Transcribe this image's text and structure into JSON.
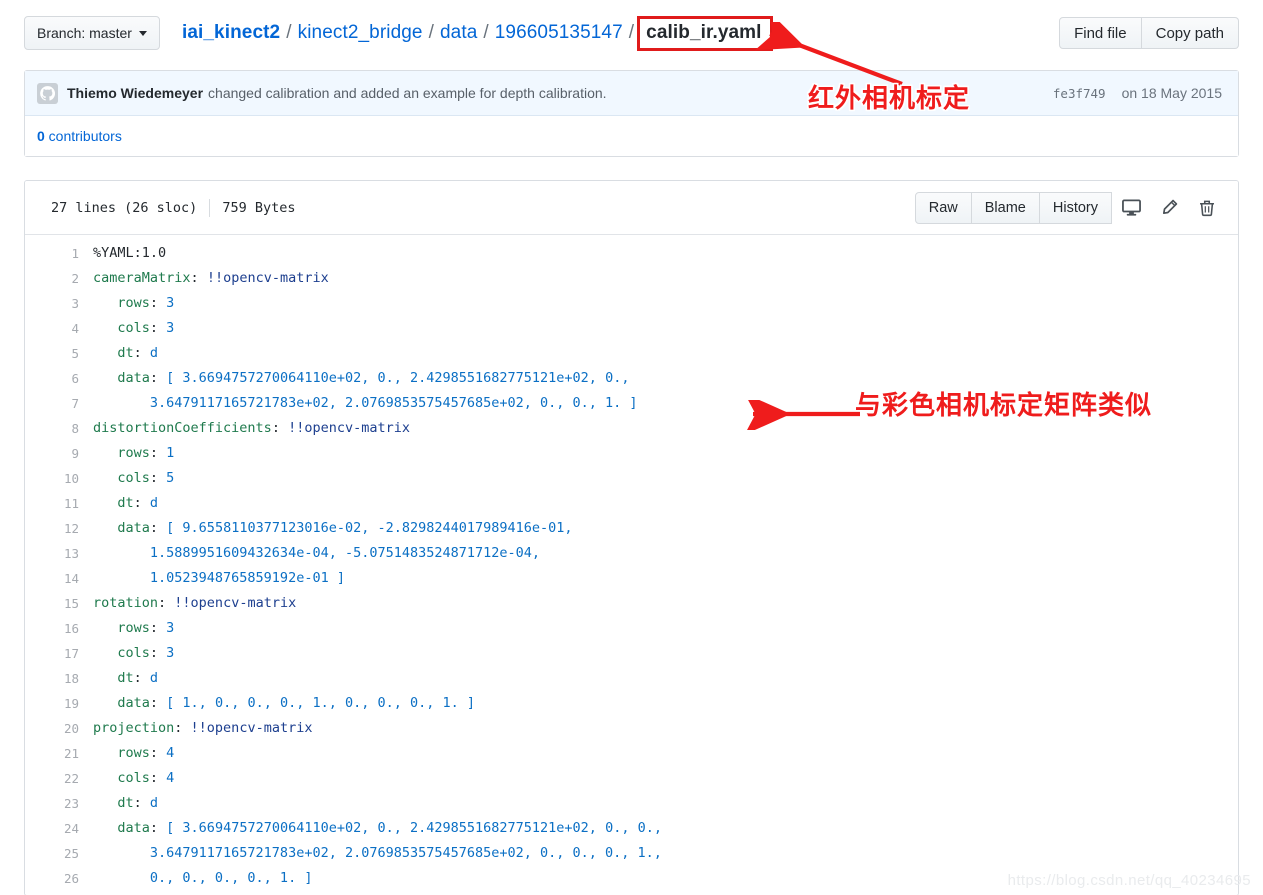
{
  "header": {
    "branch_button": "Branch: master",
    "breadcrumb": [
      {
        "text": "iai_kinect2",
        "type": "link-bold"
      },
      {
        "text": "kinect2_bridge",
        "type": "link"
      },
      {
        "text": "data",
        "type": "link"
      },
      {
        "text": "196605135147",
        "type": "link"
      },
      {
        "text": "calib_ir.yaml",
        "type": "current",
        "highlighted": true
      }
    ],
    "separator": "/",
    "find_file_label": "Find file",
    "copy_path_label": "Copy path"
  },
  "commit": {
    "author": "Thiemo Wiedemeyer",
    "message": "changed calibration and added an example for depth calibration.",
    "sha": "fe3f749",
    "date": "on 18 May 2015",
    "contributors_count": "0",
    "contributors_label": " contributors"
  },
  "file": {
    "lines_info": "27 lines (26 sloc)",
    "size": "759 Bytes",
    "buttons": [
      "Raw",
      "Blame",
      "History"
    ],
    "icons": [
      "desktop-icon",
      "pencil-icon",
      "trash-icon"
    ]
  },
  "code": {
    "language": "yaml",
    "lines": [
      {
        "n": "1",
        "tokens": [
          {
            "t": "p",
            "v": "%YAML:1.0"
          }
        ]
      },
      {
        "n": "2",
        "tokens": [
          {
            "t": "k",
            "v": "cameraMatrix"
          },
          {
            "t": "p",
            "v": ": "
          },
          {
            "t": "t",
            "v": "!!opencv-matrix"
          }
        ]
      },
      {
        "n": "3",
        "tokens": [
          {
            "t": "k",
            "v": "   rows"
          },
          {
            "t": "p",
            "v": ": "
          },
          {
            "t": "n",
            "v": "3"
          }
        ]
      },
      {
        "n": "4",
        "tokens": [
          {
            "t": "k",
            "v": "   cols"
          },
          {
            "t": "p",
            "v": ": "
          },
          {
            "t": "n",
            "v": "3"
          }
        ]
      },
      {
        "n": "5",
        "tokens": [
          {
            "t": "k",
            "v": "   dt"
          },
          {
            "t": "p",
            "v": ": "
          },
          {
            "t": "n",
            "v": "d"
          }
        ]
      },
      {
        "n": "6",
        "tokens": [
          {
            "t": "k",
            "v": "   data"
          },
          {
            "t": "p",
            "v": ": "
          },
          {
            "t": "n",
            "v": "[ 3.6694757270064110e+02, 0., 2.4298551682775121e+02, 0.,"
          }
        ]
      },
      {
        "n": "7",
        "tokens": [
          {
            "t": "n",
            "v": "       3.6479117165721783e+02, 2.0769853575457685e+02, 0., 0., 1. ]"
          }
        ]
      },
      {
        "n": "8",
        "tokens": [
          {
            "t": "k",
            "v": "distortionCoefficients"
          },
          {
            "t": "p",
            "v": ": "
          },
          {
            "t": "t",
            "v": "!!opencv-matrix"
          }
        ]
      },
      {
        "n": "9",
        "tokens": [
          {
            "t": "k",
            "v": "   rows"
          },
          {
            "t": "p",
            "v": ": "
          },
          {
            "t": "n",
            "v": "1"
          }
        ]
      },
      {
        "n": "10",
        "tokens": [
          {
            "t": "k",
            "v": "   cols"
          },
          {
            "t": "p",
            "v": ": "
          },
          {
            "t": "n",
            "v": "5"
          }
        ]
      },
      {
        "n": "11",
        "tokens": [
          {
            "t": "k",
            "v": "   dt"
          },
          {
            "t": "p",
            "v": ": "
          },
          {
            "t": "n",
            "v": "d"
          }
        ]
      },
      {
        "n": "12",
        "tokens": [
          {
            "t": "k",
            "v": "   data"
          },
          {
            "t": "p",
            "v": ": "
          },
          {
            "t": "n",
            "v": "[ 9.6558110377123016e-02, -2.8298244017989416e-01,"
          }
        ]
      },
      {
        "n": "13",
        "tokens": [
          {
            "t": "n",
            "v": "       1.5889951609432634e-04, -5.0751483524871712e-04,"
          }
        ]
      },
      {
        "n": "14",
        "tokens": [
          {
            "t": "n",
            "v": "       1.0523948765859192e-01 ]"
          }
        ]
      },
      {
        "n": "15",
        "tokens": [
          {
            "t": "k",
            "v": "rotation"
          },
          {
            "t": "p",
            "v": ": "
          },
          {
            "t": "t",
            "v": "!!opencv-matrix"
          }
        ]
      },
      {
        "n": "16",
        "tokens": [
          {
            "t": "k",
            "v": "   rows"
          },
          {
            "t": "p",
            "v": ": "
          },
          {
            "t": "n",
            "v": "3"
          }
        ]
      },
      {
        "n": "17",
        "tokens": [
          {
            "t": "k",
            "v": "   cols"
          },
          {
            "t": "p",
            "v": ": "
          },
          {
            "t": "n",
            "v": "3"
          }
        ]
      },
      {
        "n": "18",
        "tokens": [
          {
            "t": "k",
            "v": "   dt"
          },
          {
            "t": "p",
            "v": ": "
          },
          {
            "t": "n",
            "v": "d"
          }
        ]
      },
      {
        "n": "19",
        "tokens": [
          {
            "t": "k",
            "v": "   data"
          },
          {
            "t": "p",
            "v": ": "
          },
          {
            "t": "n",
            "v": "[ 1., 0., 0., 0., 1., 0., 0., 0., 1. ]"
          }
        ]
      },
      {
        "n": "20",
        "tokens": [
          {
            "t": "k",
            "v": "projection"
          },
          {
            "t": "p",
            "v": ": "
          },
          {
            "t": "t",
            "v": "!!opencv-matrix"
          }
        ]
      },
      {
        "n": "21",
        "tokens": [
          {
            "t": "k",
            "v": "   rows"
          },
          {
            "t": "p",
            "v": ": "
          },
          {
            "t": "n",
            "v": "4"
          }
        ]
      },
      {
        "n": "22",
        "tokens": [
          {
            "t": "k",
            "v": "   cols"
          },
          {
            "t": "p",
            "v": ": "
          },
          {
            "t": "n",
            "v": "4"
          }
        ]
      },
      {
        "n": "23",
        "tokens": [
          {
            "t": "k",
            "v": "   dt"
          },
          {
            "t": "p",
            "v": ": "
          },
          {
            "t": "n",
            "v": "d"
          }
        ]
      },
      {
        "n": "24",
        "tokens": [
          {
            "t": "k",
            "v": "   data"
          },
          {
            "t": "p",
            "v": ": "
          },
          {
            "t": "n",
            "v": "[ 3.6694757270064110e+02, 0., 2.4298551682775121e+02, 0., 0.,"
          }
        ]
      },
      {
        "n": "25",
        "tokens": [
          {
            "t": "n",
            "v": "       3.6479117165721783e+02, 2.0769853575457685e+02, 0., 0., 0., 1.,"
          }
        ]
      },
      {
        "n": "26",
        "tokens": [
          {
            "t": "n",
            "v": "       0., 0., 0., 0., 1. ]"
          }
        ]
      }
    ]
  },
  "annotations": {
    "ir_calibration": "红外相机标定",
    "similar_matrix": "与彩色相机标定矩阵类似"
  },
  "watermark": "https://blog.csdn.net/qq_40234695",
  "colors": {
    "link": "#0366d6",
    "annotation_red": "#ef1c1c",
    "commit_bar_bg": "#f1f8ff",
    "yaml_key": "#1f7a4d",
    "yaml_tag": "#1d3f8f",
    "yaml_number": "#0b6fc4"
  }
}
